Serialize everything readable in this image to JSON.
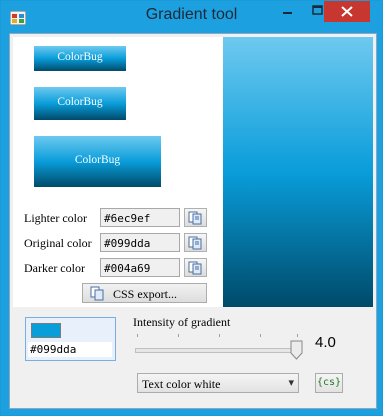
{
  "window": {
    "title": "Gradient tool",
    "controls": [
      "minimize",
      "maximize",
      "close"
    ]
  },
  "colors": {
    "lighter": "#6ec9ef",
    "original": "#099dda",
    "darker": "#004a69",
    "titlebar": "#1ca0e0",
    "close": "#c7372f"
  },
  "samples": [
    {
      "label": "ColorBug"
    },
    {
      "label": "ColorBug"
    },
    {
      "label": "ColorBug"
    }
  ],
  "fields": [
    {
      "label": "Lighter color",
      "value": "#6ec9ef",
      "icon": "copy-icon"
    },
    {
      "label": "Original color",
      "value": "#099dda",
      "icon": "copy-icon"
    },
    {
      "label": "Darker color",
      "value": "#004a69",
      "icon": "copy-icon"
    }
  ],
  "css_export": {
    "label": "CSS export...",
    "icon": "css-export-icon"
  },
  "picker": {
    "hex": "#099dda"
  },
  "intensity": {
    "label": "Intensity of gradient",
    "value_text": "4.0",
    "value": 4.0
  },
  "text_color": {
    "selected": "Text color white"
  },
  "cs_button": {
    "label": "{cs}"
  }
}
